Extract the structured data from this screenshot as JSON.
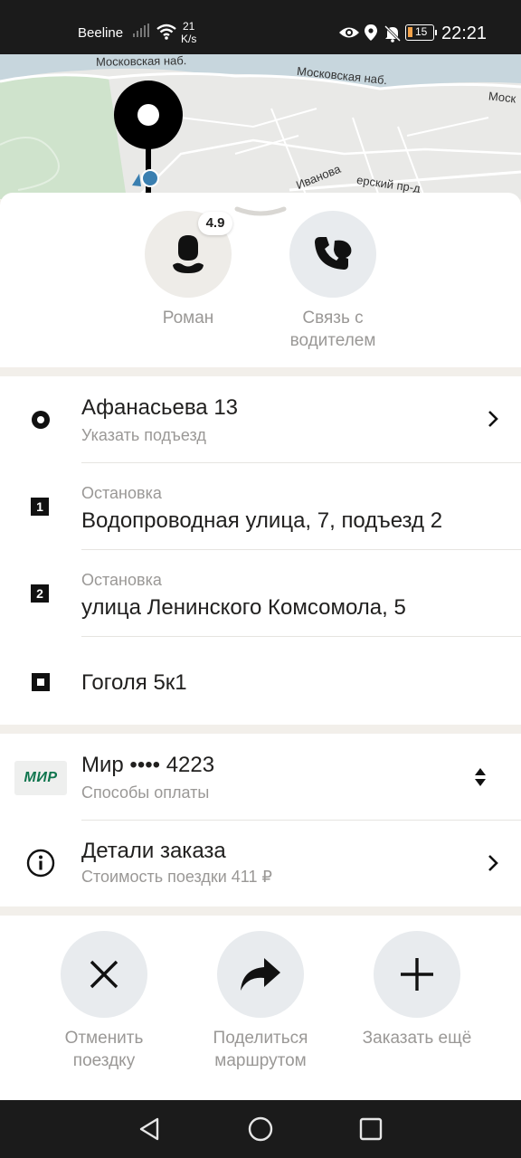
{
  "status_bar": {
    "carrier": "Beeline",
    "net_speed_value": "21",
    "net_speed_unit": "K/s",
    "battery": "15",
    "time": "22:21"
  },
  "map": {
    "labels": [
      "Московская наб.",
      "Московская наб.",
      "Моск",
      "Иванова",
      "ерский пр-д"
    ]
  },
  "driver": {
    "name": "Роман",
    "rating": "4.9",
    "contact_label": "Связь с водителем"
  },
  "route": {
    "pickup": {
      "title": "Афанасьева 13",
      "subtitle": "Указать подъезд"
    },
    "stops": [
      {
        "number": "1",
        "label": "Остановка",
        "address": "Водопроводная улица, 7, подъезд 2"
      },
      {
        "number": "2",
        "label": "Остановка",
        "address": "улица Ленинского Комсомола, 5"
      }
    ],
    "destination": {
      "title": "Гоголя 5к1"
    }
  },
  "payment": {
    "logo_text": "МИР",
    "card_title": "Мир •••• 4223",
    "subtitle": "Способы оплаты"
  },
  "order_details": {
    "title": "Детали заказа",
    "subtitle": "Стоимость поездки 411 ₽"
  },
  "actions": [
    {
      "label": "Отменить поездку",
      "icon": "close-icon"
    },
    {
      "label": "Поделиться маршрутом",
      "icon": "share-arrow-icon"
    },
    {
      "label": "Заказать ещё",
      "icon": "plus-icon"
    }
  ],
  "colors": {
    "sheet_bg": "#f2efea",
    "card_bg": "#ffffff",
    "circle_bg": "#eeece8",
    "mir_green": "#0f754e",
    "system_bar": "#1b1b1b"
  }
}
